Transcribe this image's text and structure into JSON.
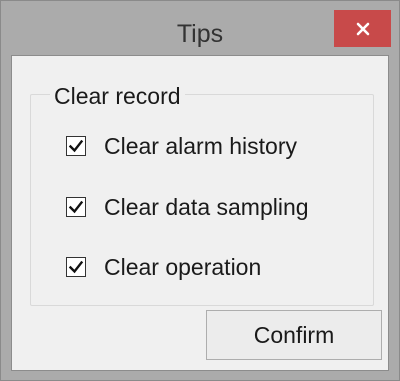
{
  "dialog": {
    "title": "Tips",
    "close_icon": "close-x-icon",
    "accent_close": "#c84a4a"
  },
  "group": {
    "label": "Clear record",
    "options": [
      {
        "label": "Clear alarm history",
        "checked": true
      },
      {
        "label": "Clear data sampling",
        "checked": true
      },
      {
        "label": "Clear operation",
        "checked": true
      }
    ]
  },
  "buttons": {
    "confirm_label": "Confirm"
  }
}
